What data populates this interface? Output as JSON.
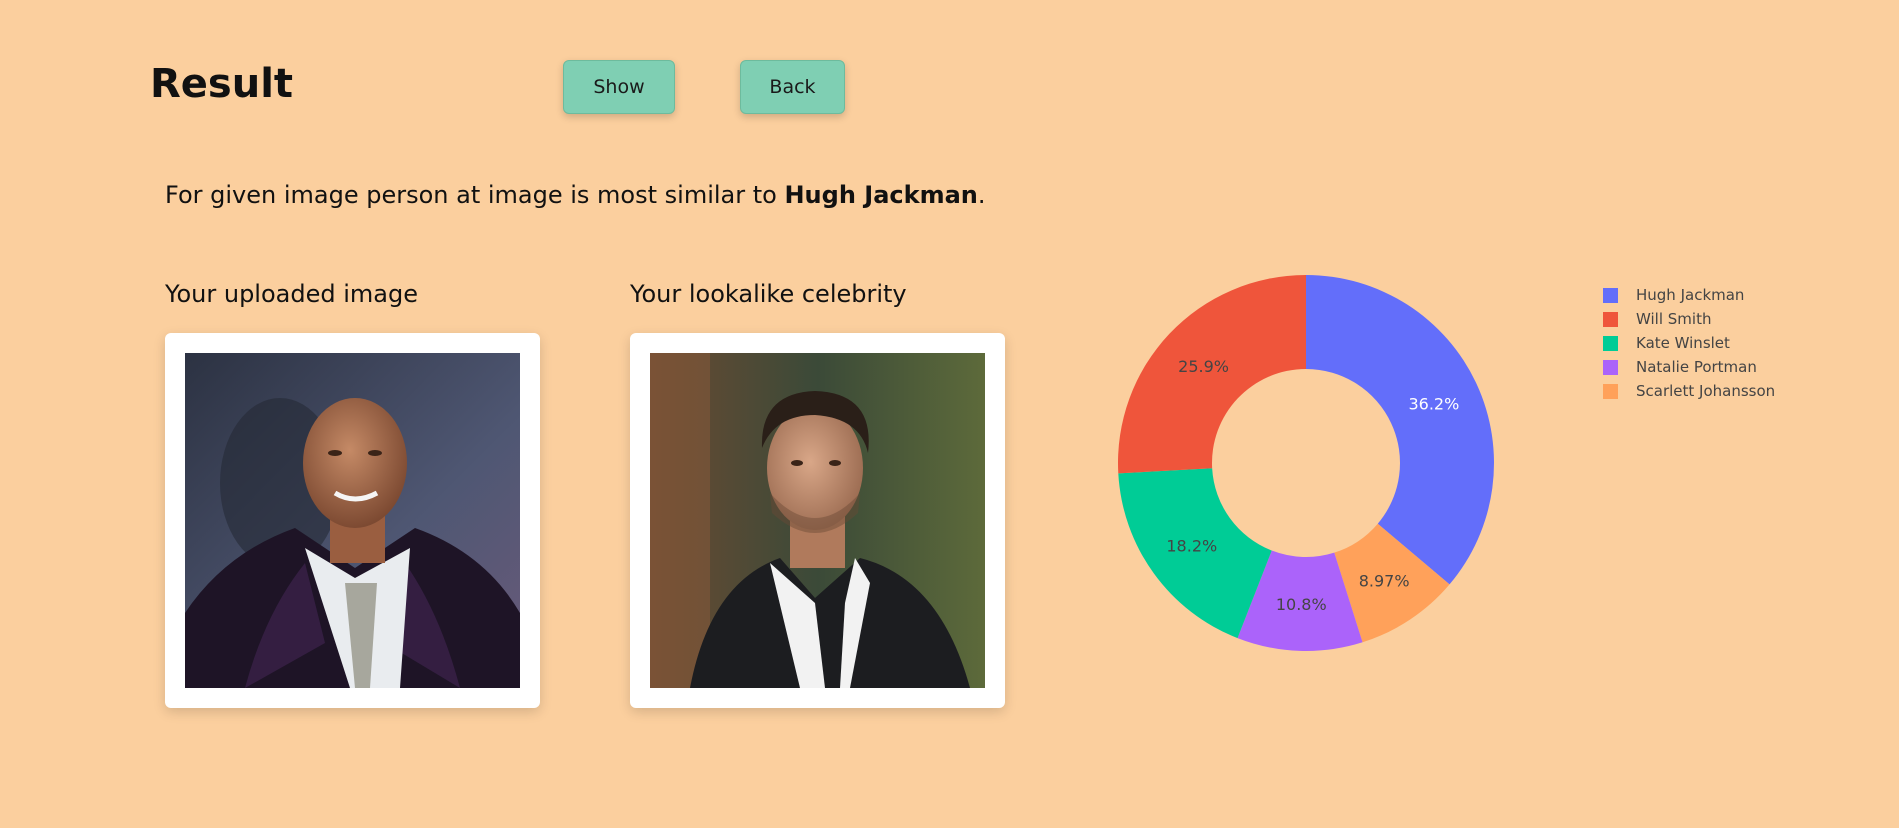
{
  "header": {
    "title": "Result",
    "show_label": "Show",
    "back_label": "Back"
  },
  "result": {
    "prefix": "For given image person at image is most similar to ",
    "name": "Hugh Jackman",
    "suffix": "."
  },
  "uploaded": {
    "heading": "Your uploaded image"
  },
  "lookalike": {
    "heading": "Your lookalike celebrity"
  },
  "chart_data": {
    "type": "pie",
    "hole": true,
    "legend_position": "right",
    "categories": [
      "Hugh Jackman",
      "Will Smith",
      "Kate Winslet",
      "Natalie Portman",
      "Scarlett Johansson"
    ],
    "values": [
      36.2,
      25.9,
      18.2,
      10.8,
      8.97
    ],
    "labels": [
      "36.2%",
      "25.9%",
      "18.2%",
      "10.8%",
      "8.97%"
    ],
    "colors": [
      "#636efa",
      "#ef553b",
      "#00cc96",
      "#ab63fa",
      "#ffa15a"
    ],
    "label_colors": [
      "#ffffff",
      "#444444",
      "#444444",
      "#444444",
      "#444444"
    ],
    "display_order": [
      0,
      4,
      3,
      2,
      1
    ]
  }
}
